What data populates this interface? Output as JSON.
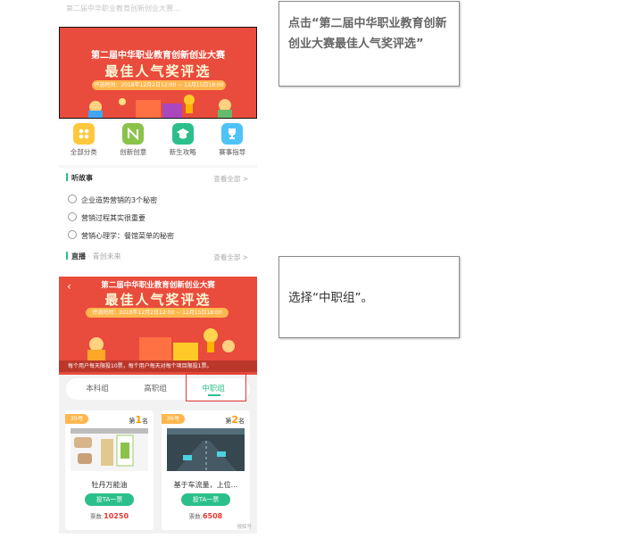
{
  "callouts": {
    "step1": "点击“第二届中华职业教育创新创业大赛最佳人气奖评选”",
    "step2": "选择“中职组”。"
  },
  "screen1": {
    "top_text": "第二届中华职业教育创新创业大赛...",
    "banner": {
      "title_small": "第二届中华职业教育创新创业大赛",
      "title_big": "最佳人气奖评选",
      "time": "评选时间：2018年12月2日12:00 ~ 12月15日18:00"
    },
    "categories": [
      {
        "label": "全部分类",
        "icon": "grid-icon",
        "color": "#ffc83d"
      },
      {
        "label": "创新创意",
        "icon": "n-icon",
        "color": "#8bc34a"
      },
      {
        "label": "新生攻略",
        "icon": "graduation-cap-icon",
        "color": "#2bc08b"
      },
      {
        "label": "赛事指导",
        "icon": "trophy-icon",
        "color": "#4fc3f7"
      }
    ],
    "stories": {
      "heading": "听故事",
      "more": "查看全部 >",
      "items": [
        "企业造势营销的3个秘密",
        "营销过程其实很重要",
        "营销心理学：餐馆菜单的秘密"
      ]
    },
    "live": {
      "heading": "直播",
      "sub": " · 青创未来",
      "more": "查看全部 >"
    }
  },
  "screen2": {
    "back": "‹",
    "banner": {
      "title_small": "第二届中华职业教育创新创业大赛",
      "title_big": "最佳人气奖评选",
      "time": "评选时间：2018年12月2日12:00 ~ 12月15日18:00",
      "notice": "每个用户每天限投10票，每个用户每天对每个项目限投1票。"
    },
    "tabs": [
      {
        "label": "本科组",
        "active": false
      },
      {
        "label": "高职组",
        "active": false
      },
      {
        "label": "中职组",
        "active": true
      }
    ],
    "cards": [
      {
        "badge": "39号",
        "rank_prefix": "第",
        "rank": "1",
        "rank_suffix": "名",
        "name": "牡丹万能油",
        "vote_label": "投TA一票",
        "votes_label": "票数:",
        "votes": "10250"
      },
      {
        "badge": "36号",
        "rank_prefix": "第",
        "rank": "2",
        "rank_suffix": "名",
        "name": "基于车流量，上位...",
        "vote_label": "投TA一票",
        "votes_label": "票数:",
        "votes": "6508"
      }
    ],
    "watermark": "搜狐号"
  },
  "colors": {
    "accent": "#2bc08b",
    "banner": "#e94b3c",
    "highlight": "#e53935"
  }
}
